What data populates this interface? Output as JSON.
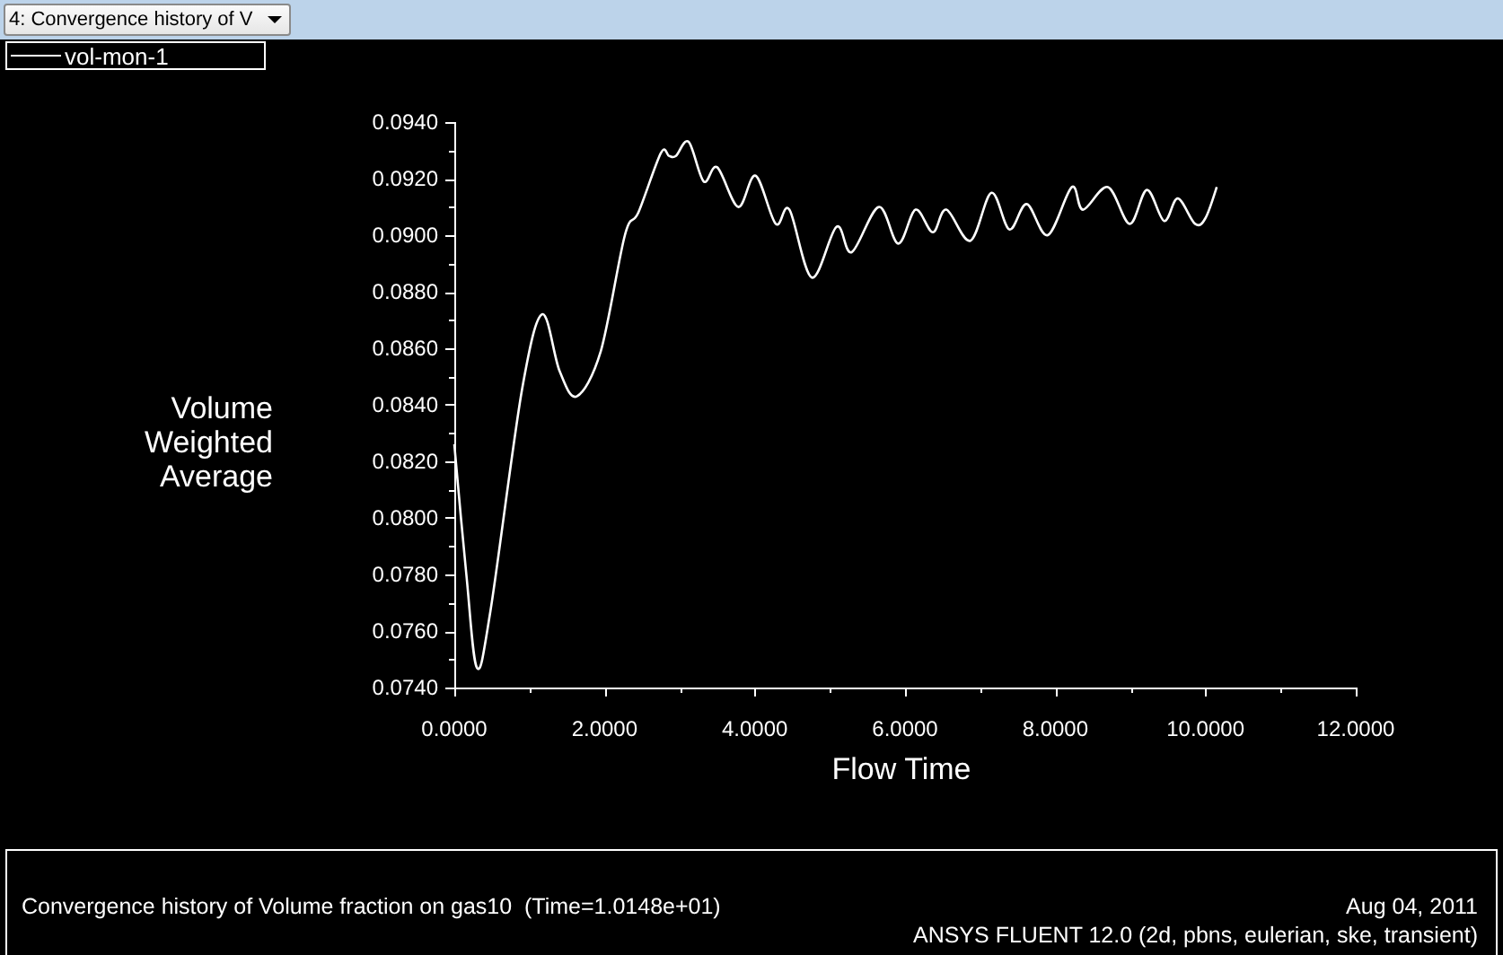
{
  "toolbar": {
    "dropdown": {
      "value": "4: Convergence history of V"
    }
  },
  "plot": {
    "chart_data": {
      "type": "line",
      "xlabel": "Flow Time",
      "ylabel": "Volume Weighted Average",
      "x": [
        0,
        0.16,
        0.3,
        0.48,
        0.9,
        1.17,
        1.4,
        1.63,
        1.95,
        2.27,
        2.45,
        2.75,
        2.86,
        2.95,
        3.12,
        3.32,
        3.5,
        3.78,
        4.01,
        4.28,
        4.46,
        4.76,
        5.09,
        5.29,
        5.65,
        5.91,
        6.14,
        6.37,
        6.55,
        6.87,
        7.15,
        7.39,
        7.62,
        7.9,
        8.22,
        8.37,
        8.7,
        8.99,
        9.22,
        9.45,
        9.63,
        9.86,
        10.0,
        10.15
      ],
      "series": [
        {
          "name": "vol-mon-1",
          "color": "#ffffff",
          "values": [
            0.0826,
            0.078,
            0.0747,
            0.0767,
            0.0845,
            0.0872,
            0.0852,
            0.0843,
            0.0859,
            0.09,
            0.0908,
            0.0929,
            0.0928,
            0.0928,
            0.0933,
            0.0919,
            0.0924,
            0.091,
            0.0921,
            0.0904,
            0.0909,
            0.0885,
            0.0903,
            0.0894,
            0.091,
            0.0897,
            0.0909,
            0.0901,
            0.0909,
            0.0898,
            0.0915,
            0.0902,
            0.0911,
            0.09,
            0.0917,
            0.0909,
            0.0917,
            0.0904,
            0.0916,
            0.0905,
            0.0913,
            0.0904,
            0.0906,
            0.0917
          ]
        }
      ],
      "xlim": [
        0,
        12
      ],
      "ylim": [
        0.074,
        0.094
      ],
      "xticks": [
        {
          "value": 0,
          "label": "0.0000"
        },
        {
          "value": 2,
          "label": "2.0000"
        },
        {
          "value": 4,
          "label": "4.0000"
        },
        {
          "value": 6,
          "label": "6.0000"
        },
        {
          "value": 8,
          "label": "8.0000"
        },
        {
          "value": 10,
          "label": "10.0000"
        },
        {
          "value": 12,
          "label": "12.0000"
        }
      ],
      "yticks": [
        {
          "value": 0.074,
          "label": "0.0740"
        },
        {
          "value": 0.076,
          "label": "0.0760"
        },
        {
          "value": 0.078,
          "label": "0.0780"
        },
        {
          "value": 0.08,
          "label": "0.0800"
        },
        {
          "value": 0.082,
          "label": "0.0820"
        },
        {
          "value": 0.084,
          "label": "0.0840"
        },
        {
          "value": 0.086,
          "label": "0.0860"
        },
        {
          "value": 0.088,
          "label": "0.0880"
        },
        {
          "value": 0.09,
          "label": "0.0900"
        },
        {
          "value": 0.092,
          "label": "0.0920"
        },
        {
          "value": 0.094,
          "label": "0.0940"
        }
      ]
    }
  },
  "footer": {
    "title": "Convergence history of Volume fraction on gas10  (Time=1.0148e+01)",
    "date": "Aug 04, 2011",
    "version": "ANSYS FLUENT 12.0 (2d, pbns, eulerian, ske, transient)"
  }
}
